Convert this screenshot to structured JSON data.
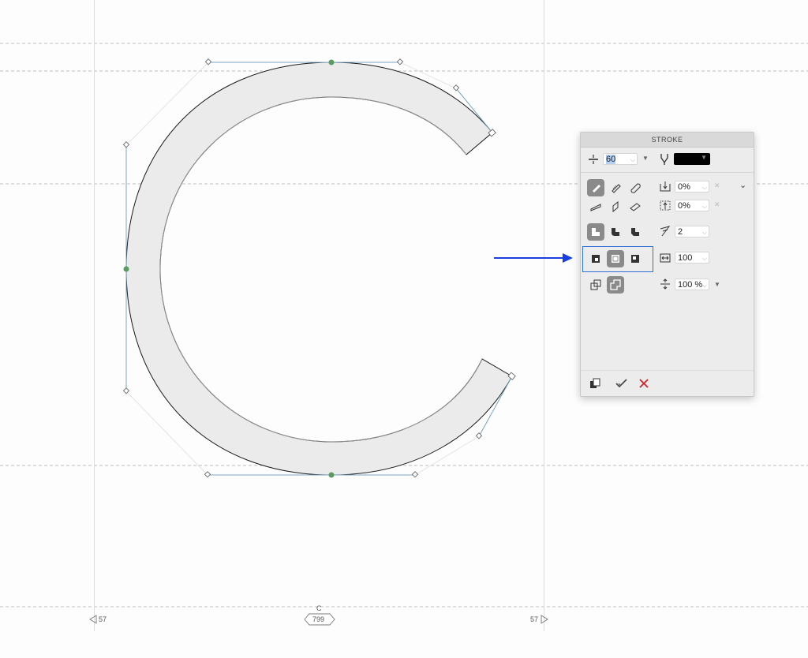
{
  "panel": {
    "title": "STROKE",
    "stroke_width": "60",
    "stroke_color": "#000000",
    "offset_1": "0%",
    "offset_2": "0%",
    "miter_limit": "2",
    "width_value": "100",
    "scale_value": "100 %"
  },
  "glyph": {
    "name": "C",
    "advance": "799",
    "lsb": "57",
    "rsb": "57"
  },
  "colors": {
    "arrow": "#1a3fe0",
    "highlight_box": "#2f6fd6",
    "node": "#5b9a62",
    "handle_line": "#7ba7c6",
    "cancel": "#d2232a",
    "fill": "#ebebeb"
  },
  "icons": [
    "stroke-width-icon",
    "pen-nib-icon",
    "cap-butt-icon",
    "join-miter-icon",
    "align-center-icon",
    "overlap-icon",
    "confirm-check-icon",
    "cancel-x-icon",
    "duplicate-icon",
    "arrow-right-icon"
  ]
}
